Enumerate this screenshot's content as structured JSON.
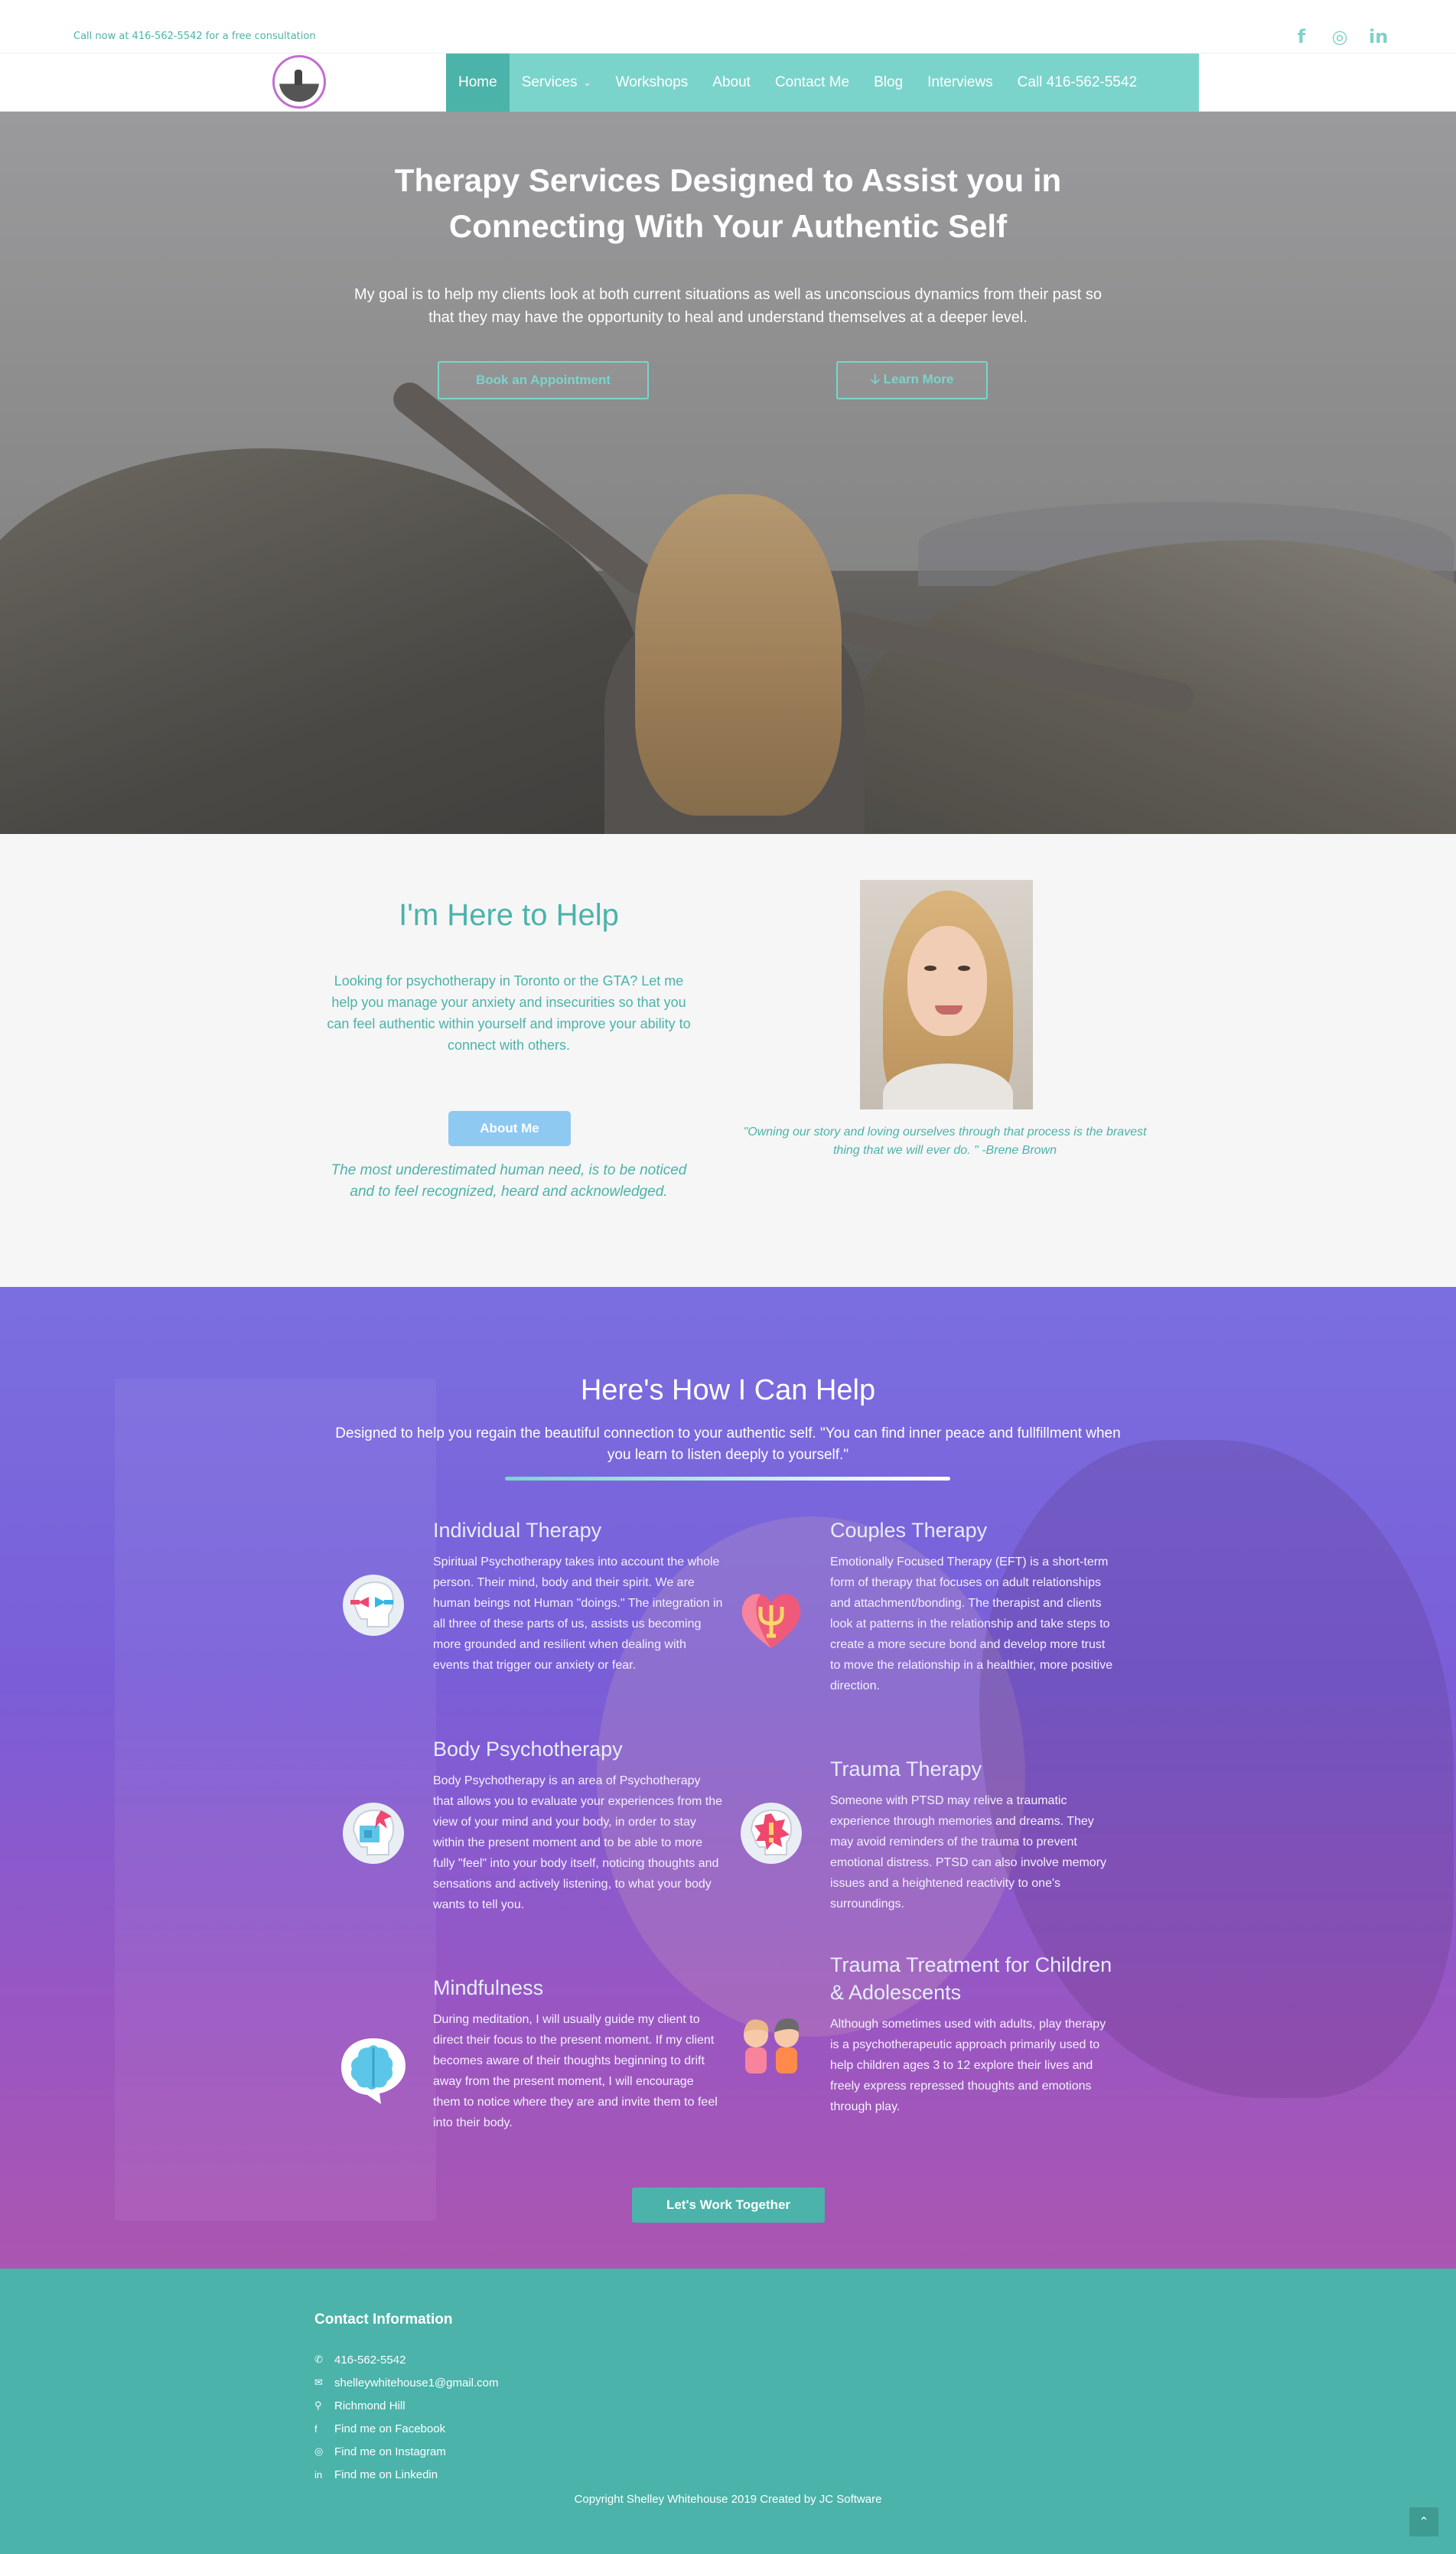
{
  "topbar": {
    "call_text": "Call now at 416-562-5542 for a free consultation",
    "social": [
      {
        "icon": "facebook-icon",
        "glyph": "f"
      },
      {
        "icon": "instagram-icon",
        "glyph": "◎"
      },
      {
        "icon": "linkedin-icon",
        "glyph": "in"
      }
    ]
  },
  "nav": {
    "items": [
      {
        "label": "Home",
        "active": true
      },
      {
        "label": "Services",
        "caret": "⌄"
      },
      {
        "label": "Workshops"
      },
      {
        "label": "About"
      },
      {
        "label": "Contact Me"
      },
      {
        "label": "Blog"
      },
      {
        "label": "Interviews"
      },
      {
        "label": "Call 416-562-5542"
      }
    ]
  },
  "hero": {
    "title_line1": "Therapy Services Designed to Assist you in",
    "title_line2": "Connecting With Your Authentic Self",
    "lead": "My goal is to help my clients look at both current situations as well as unconscious dynamics from their past so that they may have the opportunity to heal and understand themselves at a deeper level.",
    "book_label": "Book an Appointment",
    "learn_label": "🡣 Learn More"
  },
  "help": {
    "title": "I'm Here to Help",
    "intro": "Looking for psychotherapy in Toronto or the GTA? Let me help you manage your anxiety and insecurities so that you can feel authentic within yourself and improve your ability to connect with others.",
    "about_label": "About Me",
    "quote_left": "The most underestimated human need, is to be noticed and to feel recognized, heard and acknowledged.",
    "quote_right": "\"Owning our story and loving ourselves through that process is the bravest thing that we will ever do. \" -Brene Brown"
  },
  "services": {
    "title": "Here's How I Can Help",
    "subtitle": "Designed to help you regain the beautiful connection to your authentic self. \"You can find inner peace and fullfillment when you learn to listen deeply to yourself.\"",
    "items": [
      {
        "title": "Individual Therapy",
        "icon": "head-arrows-icon",
        "text": "Spiritual Psychotherapy takes into account the whole person. Their mind, body and their spirit. We are human beings not Human \"doings.\" The integration in all three of these parts of us, assists us becoming more grounded and resilient when dealing with events that trigger our anxiety or fear."
      },
      {
        "title": "Couples Therapy",
        "icon": "heart-psi-icon",
        "text": "Emotionally Focused Therapy (EFT) is a short-term form of therapy that focuses on adult relationships and attachment/bonding. The therapist and clients look at patterns in the relationship and take steps to create a more secure bond and develop more trust to move the relationship in a healthier, more positive direction."
      },
      {
        "title": "Body Psychotherapy",
        "icon": "head-puzzle-icon",
        "text": "Body Psychotherapy is an area of Psychotherapy that allows you to evaluate your experiences from the view of your mind and your body, in order to stay within the present moment and to be able to more fully \"feel\" into your body itself, noticing thoughts and sensations and actively listening, to what your body wants to tell you."
      },
      {
        "title": "Trauma Therapy",
        "icon": "head-alert-icon",
        "text": "Someone with PTSD may relive a traumatic experience through memories and dreams. They may avoid reminders of the trauma to prevent emotional distress. PTSD can also involve memory issues and a heightened reactivity to one's surroundings."
      },
      {
        "title": "Mindfulness",
        "icon": "brain-bubble-icon",
        "text": "During meditation, I will usually guide my client to direct their focus to the present moment. If my client becomes aware of their thoughts beginning to drift away from the present moment, I will encourage them to notice where they are and invite them to feel into their body."
      },
      {
        "title": "Trauma Treatment for Children & Adolescents",
        "icon": "children-icon",
        "text": "Although sometimes used with adults, play therapy is a psychotherapeutic approach primarily used to help children ages 3 to 12 explore their lives and freely express repressed thoughts and emotions through play."
      }
    ],
    "cta_label": "Let's Work Together"
  },
  "footer": {
    "title": "Contact Information",
    "items": [
      {
        "icon": "phone-icon",
        "glyph": "✆",
        "label": "416-562-5542"
      },
      {
        "icon": "envelope-icon",
        "glyph": "✉",
        "label": "shelleywhitehouse1@gmail.com"
      },
      {
        "icon": "map-pin-icon",
        "glyph": "⚲",
        "label": "Richmond Hill"
      },
      {
        "icon": "facebook-icon",
        "glyph": "f",
        "label": "Find me on Facebook"
      },
      {
        "icon": "instagram-icon",
        "glyph": "◎",
        "label": "Find me on Instagram"
      },
      {
        "icon": "linkedin-icon",
        "glyph": "in",
        "label": "Find me on Linkedin"
      }
    ],
    "copyright": "Copyright Shelley Whitehouse 2019 Created by JC Software",
    "totop_glyph": "⌃"
  }
}
